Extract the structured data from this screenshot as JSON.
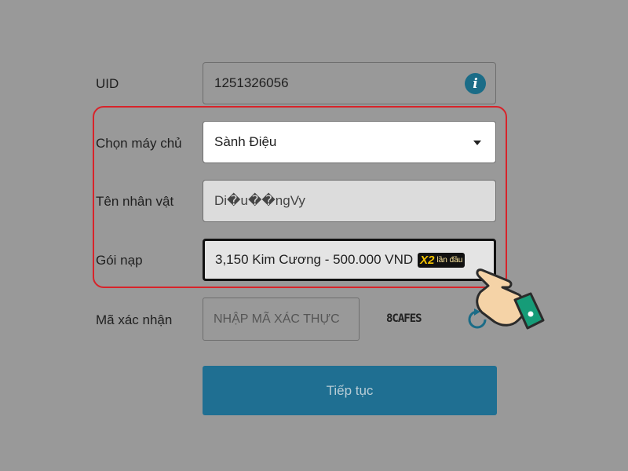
{
  "form": {
    "uid": {
      "label": "UID",
      "value": "1251326056",
      "icon": "info-icon"
    },
    "server": {
      "label": "Chọn máy chủ",
      "value": "Sành Điệu"
    },
    "character": {
      "label": "Tên nhân vật",
      "value": "Di�u��ngVy"
    },
    "package": {
      "label": "Gói nạp",
      "value": "3,150 Kim Cương - 500.000 VND",
      "badge_main": "X2",
      "badge_sub": "lần đầu"
    },
    "captcha": {
      "label": "Mã xác nhận",
      "placeholder": "NHẬP MÃ XÁC THỰC",
      "code": "8CAFES",
      "refresh_icon": "refresh-icon"
    },
    "submit_label": "Tiếp tục"
  },
  "colors": {
    "background": "#999999",
    "highlight_border": "#d8232a",
    "submit_button": "#1f6f92",
    "info_icon": "#1b6c87"
  }
}
